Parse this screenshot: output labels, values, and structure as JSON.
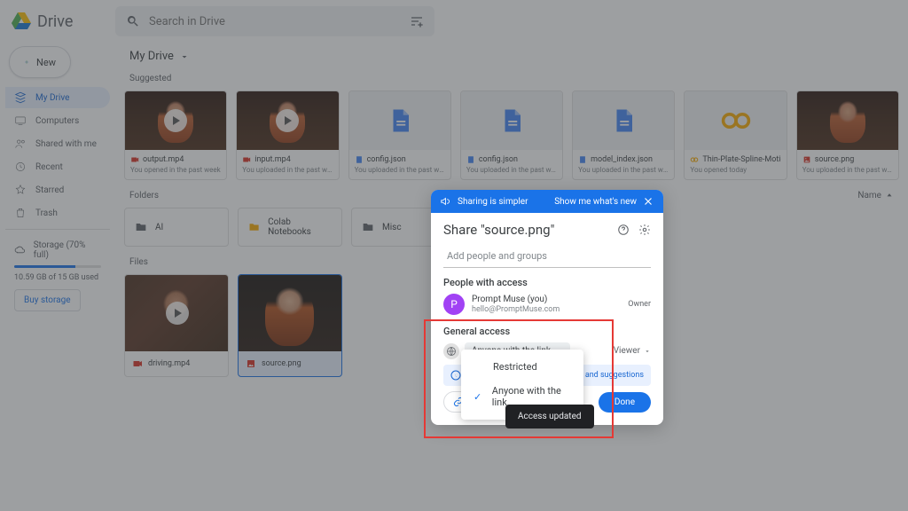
{
  "app": {
    "name": "Drive",
    "search_placeholder": "Search in Drive"
  },
  "newButton": "New",
  "sidebar": {
    "items": [
      {
        "label": "My Drive"
      },
      {
        "label": "Computers"
      },
      {
        "label": "Shared with me"
      },
      {
        "label": "Recent"
      },
      {
        "label": "Starred"
      },
      {
        "label": "Trash"
      }
    ],
    "storage": {
      "label": "Storage (70% full)",
      "percent": 70,
      "detail": "10.59 GB of 15 GB used",
      "buy": "Buy storage"
    }
  },
  "breadcrumb": "My Drive",
  "suggestedLabel": "Suggested",
  "suggested": [
    {
      "name": "output.mp4",
      "sub": "You opened in the past week",
      "type": "video"
    },
    {
      "name": "input.mp4",
      "sub": "You uploaded in the past week",
      "type": "video"
    },
    {
      "name": "config.json",
      "sub": "You uploaded in the past week",
      "type": "doc"
    },
    {
      "name": "config.json",
      "sub": "You uploaded in the past week",
      "type": "doc"
    },
    {
      "name": "model_index.json",
      "sub": "You uploaded in the past week",
      "type": "doc"
    },
    {
      "name": "Thin-Plate-Spline-Motion-M...",
      "sub": "You opened today",
      "type": "colab"
    },
    {
      "name": "source.png",
      "sub": "You uploaded in the past week",
      "type": "image"
    }
  ],
  "foldersLabel": "Folders",
  "sortLabel": "Name",
  "folders": [
    {
      "name": "AI"
    },
    {
      "name": "Colab Notebooks"
    },
    {
      "name": "Misc"
    }
  ],
  "filesLabel": "Files",
  "files": [
    {
      "name": "driving.mp4",
      "type": "video"
    },
    {
      "name": "source.png",
      "type": "image",
      "selected": true
    }
  ],
  "dialog": {
    "bannerText": "Sharing is simpler",
    "bannerLink": "Show me what's new",
    "title": "Share \"source.png\"",
    "addPeople": "Add people and groups",
    "peopleHeader": "People with access",
    "person": {
      "initial": "P",
      "name": "Prompt Muse (you)",
      "email": "hello@PromptMuse.com",
      "role": "Owner"
    },
    "generalHeader": "General access",
    "accessChip": "Anyone with the link",
    "roleLabel": "Viewer",
    "infoText": "and suggestions",
    "copyLink": "Copy link",
    "done": "Done"
  },
  "dropdown": {
    "opt1": "Restricted",
    "opt2": "Anyone with the link"
  },
  "toast": "Access updated"
}
